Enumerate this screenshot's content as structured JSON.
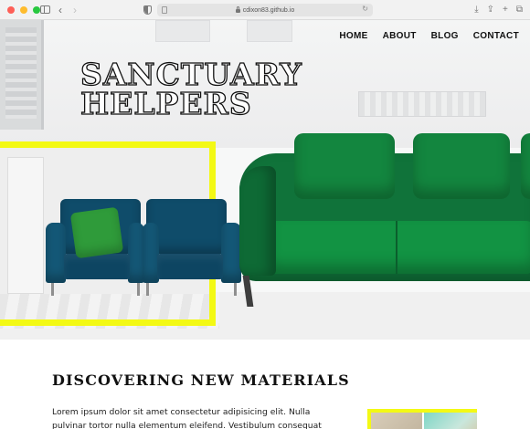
{
  "browser": {
    "url": "cdixon83.github.io"
  },
  "nav": {
    "items": [
      {
        "label": "HOME"
      },
      {
        "label": "ABOUT"
      },
      {
        "label": "BLOG"
      },
      {
        "label": "CONTACT"
      }
    ]
  },
  "hero": {
    "title_line1": "SANCTUARY",
    "title_line2": "HELPERS"
  },
  "section": {
    "title": "DISCOVERING NEW MATERIALS",
    "body": "Lorem ipsum dolor sit amet consectetur adipisicing elit. Nulla pulvinar tortor nulla elementum eleifend. Vestibulum consequat"
  },
  "colors": {
    "accent_yellow": "#f3f915",
    "sofa_green": "#10733a",
    "armchair_blue": "#0f4c6a",
    "text": "#111111"
  },
  "icons": [
    "sidebar-icon",
    "back-icon",
    "forward-icon",
    "shield-icon",
    "lock-icon",
    "reload-icon",
    "download-icon",
    "share-icon",
    "new-tab-icon",
    "tabs-icon"
  ]
}
